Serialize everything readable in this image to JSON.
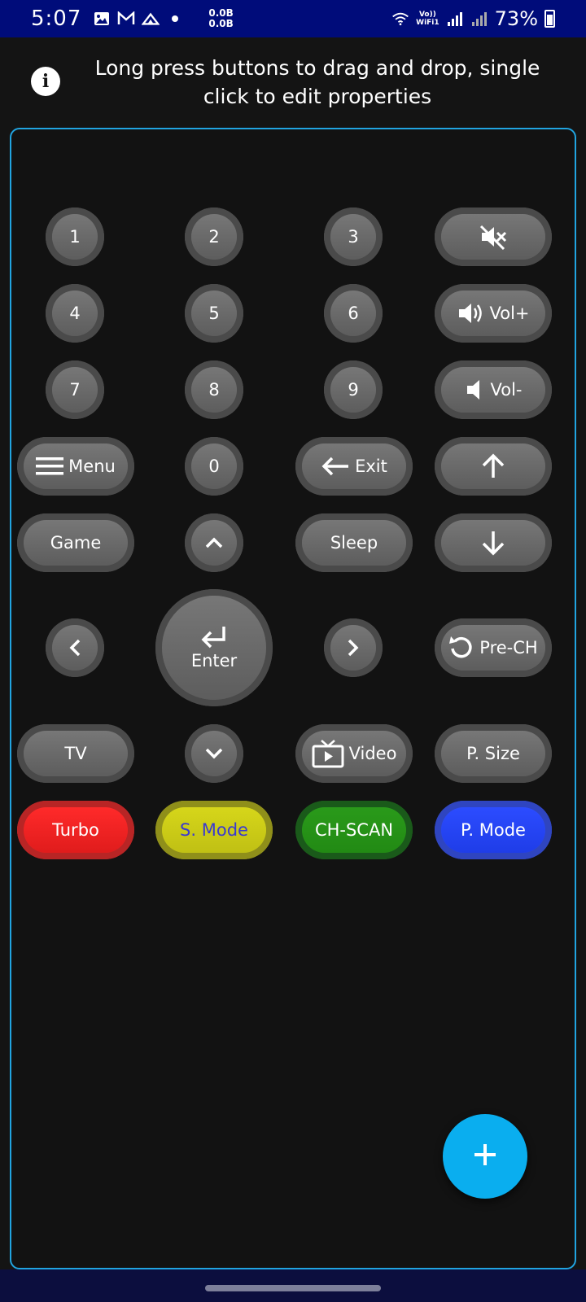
{
  "status_bar": {
    "time": "5:07",
    "net_speed_up": "0.0B",
    "net_speed_down": "0.0B",
    "volte_top": "Vo))",
    "volte_bottom": "WiFi1",
    "battery": "73%"
  },
  "hint": {
    "text": "Long press buttons to drag and drop, single click to edit properties"
  },
  "buttons": {
    "b1": "1",
    "b2": "2",
    "b3": "3",
    "b4": "4",
    "b5": "5",
    "b6": "6",
    "b7": "7",
    "b8": "8",
    "b9": "9",
    "b0": "0",
    "vol_up": "Vol+",
    "vol_down": "Vol-",
    "menu": "Menu",
    "exit": "Exit",
    "game": "Game",
    "sleep": "Sleep",
    "enter": "Enter",
    "pre_ch": "Pre-CH",
    "tv": "TV",
    "video": "Video",
    "p_size": "P. Size",
    "turbo": "Turbo",
    "s_mode": "S. Mode",
    "ch_scan": "CH-SCAN",
    "p_mode": "P. Mode"
  },
  "colors": {
    "status_bar": "#000c7a",
    "panel_border": "#21a4e0",
    "fab": "#0aaeef",
    "turbo": "#ff2a2a",
    "s_mode": "#d6d61a",
    "ch_scan": "#2a9a1a",
    "p_mode": "#2c4cff"
  },
  "icons": {
    "mute": "volume-mute-icon",
    "vol_up": "volume-up-icon",
    "vol_down": "volume-down-icon",
    "menu": "hamburger-icon",
    "exit": "arrow-left-icon",
    "up": "arrow-up-icon",
    "down": "arrow-down-icon",
    "enter": "enter-return-icon",
    "pre_ch": "rotate-left-icon",
    "video": "tv-play-icon",
    "fab": "plus-icon"
  }
}
